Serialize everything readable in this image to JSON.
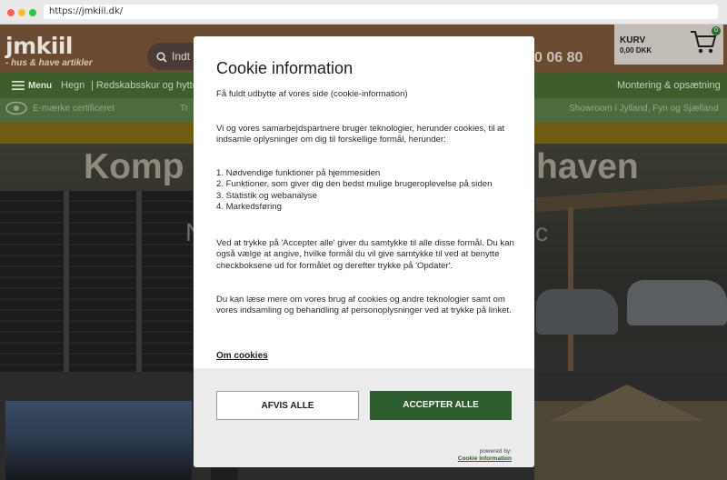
{
  "browser": {
    "url": "https://jmkiil.dk/"
  },
  "site": {
    "logo": {
      "main": "jmkiil",
      "sub": "- hus & have artikler"
    },
    "search": {
      "placeholder": "Indt"
    },
    "phone": "0 06 80",
    "cart": {
      "label": "KURV",
      "amount": "0,00 DKK",
      "count": "0"
    },
    "nav": {
      "menu": "Menu",
      "items": [
        "Hegn",
        "Redskabsskur og hytter"
      ],
      "right": "Montering & opsætning"
    },
    "subnav": {
      "left": "E-mærke certificeret",
      "middle": "Tr",
      "right": "Showroom i Jylland, Fyn og Sjælland"
    },
    "hero": {
      "title_left": "Komp",
      "title_right": "haven",
      "sub_left": "N",
      "sub_right": "c"
    }
  },
  "cookie": {
    "title": "Cookie information",
    "intro": "Få fuldt udbytte af vores side (cookie-information)",
    "partners": "Vi og vores samarbejdspartnere bruger teknologier, herunder cookies, til at indsamle oplysninger om dig til forskellige formål, herunder:",
    "purposes": [
      "1. Nødvendige funktioner på hjemmesiden",
      "2. Funktioner, som giver dig den bedst mulige brugeroplevelse på siden",
      "3. Statistik og webanalyse",
      "4. Markedsføring"
    ],
    "accept_text": "Ved at trykke på 'Accepter alle' giver du samtykke til alle disse formål. Du kan også vælge at angive, hvilke formål du vil give samtykke til ved at benytte checkboksene ud for formålet og derefter trykke på 'Opdater'.",
    "more_text": "Du kan læse mere om vores brug af cookies og andre teknologier samt om vores indsamling og behandling af personoplysninger ved at trykke på linket.",
    "link": "Om cookies",
    "decline_label": "AFVIS ALLE",
    "accept_label": "ACCEPTER ALLE",
    "powered_by": "powered by:",
    "powered_link": "Cookie Information"
  },
  "colors": {
    "accent": "#2d5d2f",
    "header": "#6a4a30",
    "nav": "#3d5e2b"
  }
}
